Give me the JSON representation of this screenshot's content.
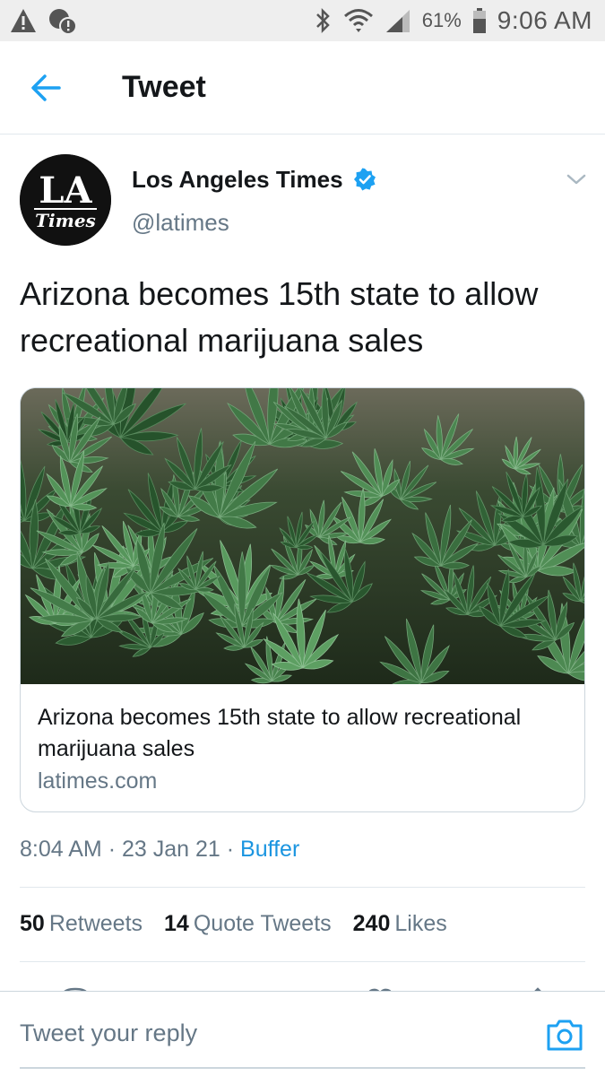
{
  "status_bar": {
    "battery_percent": "61%",
    "time": "9:06 AM",
    "icons": [
      "alert-icon",
      "notification-icon",
      "bluetooth-icon",
      "wifi-icon",
      "signal-icon",
      "battery-icon"
    ]
  },
  "header": {
    "back_icon": "arrow-left-icon",
    "title": "Tweet"
  },
  "tweet": {
    "author": {
      "name": "Los Angeles Times",
      "handle": "@latimes",
      "verified": true,
      "avatar_text_top": "LA",
      "avatar_text_bottom": "Times"
    },
    "text": "Arizona becomes 15th state to allow recreational marijuana sales",
    "card": {
      "image_subject": "cannabis plants",
      "title": "Arizona becomes 15th state to allow recreational marijuana sales",
      "domain": "latimes.com"
    },
    "time": "8:04 AM",
    "separator": "·",
    "date": "23 Jan 21",
    "source": "Buffer",
    "stats": {
      "retweets_count": "50",
      "retweets_label": "Retweets",
      "quote_count": "14",
      "quote_label": "Quote Tweets",
      "likes_count": "240",
      "likes_label": "Likes"
    }
  },
  "reply": {
    "placeholder": "Tweet your reply",
    "camera_icon": "camera-icon"
  },
  "colors": {
    "accent": "#1da1f2",
    "link": "#1b95e0",
    "text_primary": "#14171a",
    "text_secondary": "#657786",
    "border": "#e1e8ed"
  }
}
